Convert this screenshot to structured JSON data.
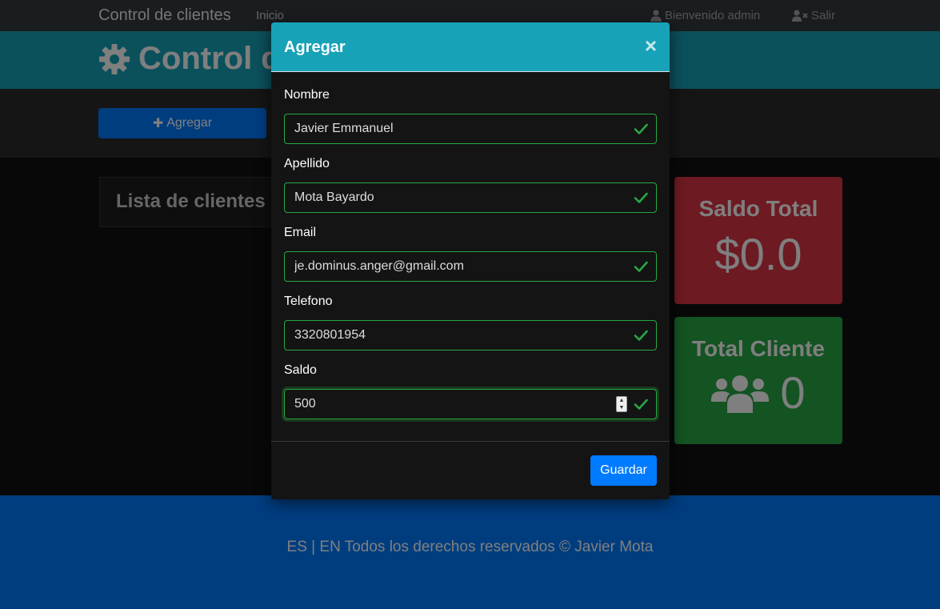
{
  "navbar": {
    "brand": "Control de clientes",
    "home_link": "Inicio",
    "welcome": "Bienvenido admin",
    "logout": "Salir"
  },
  "header": {
    "title": "Control de clientes"
  },
  "actions": {
    "add_label": "Agregar"
  },
  "clients_list": {
    "title": "Lista de clientes"
  },
  "stats": {
    "saldo_title": "Saldo Total",
    "saldo_value": "$0.0",
    "clientes_title": "Total Cliente",
    "clientes_value": "0"
  },
  "footer": {
    "lang_es": "ES",
    "separator": "|",
    "lang_en": "EN",
    "rights": "Todos los derechos reservados © Javier Mota"
  },
  "modal": {
    "title": "Agregar",
    "close": "×",
    "fields": {
      "nombre": {
        "label": "Nombre",
        "value": "Javier Emmanuel"
      },
      "apellido": {
        "label": "Apellido",
        "value": "Mota Bayardo"
      },
      "email": {
        "label": "Email",
        "value": "je.dominus.anger@gmail.com"
      },
      "telefono": {
        "label": "Telefono",
        "value": "3320801954"
      },
      "saldo": {
        "label": "Saldo",
        "value": "500"
      }
    },
    "save_label": "Guardar"
  },
  "colors": {
    "info": "#17a2b8",
    "primary": "#007bff",
    "danger": "#dc3545",
    "success": "#28a745",
    "dark": "#343a40"
  }
}
